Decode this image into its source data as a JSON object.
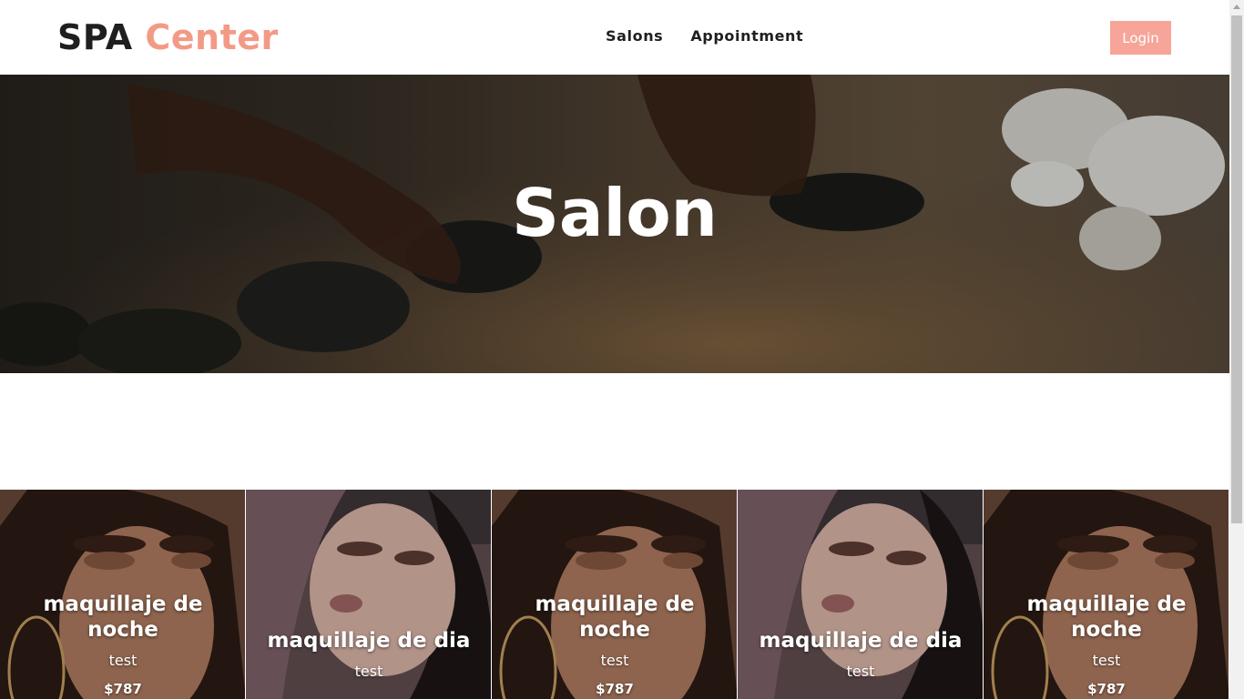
{
  "header": {
    "logo_part1": "SPA",
    "logo_part2": "Center",
    "nav": [
      "Salons",
      "Appointment"
    ],
    "login_label": "Login"
  },
  "hero": {
    "title": "Salon"
  },
  "cards": [
    {
      "title": "maquillaje de noche",
      "description": "test",
      "price": "$787"
    },
    {
      "title": "maquillaje de dia",
      "description": "test",
      "price": ""
    },
    {
      "title": "maquillaje de noche",
      "description": "test",
      "price": "$787"
    },
    {
      "title": "maquillaje de dia",
      "description": "test",
      "price": ""
    },
    {
      "title": "maquillaje de noche",
      "description": "test",
      "price": "$787"
    }
  ],
  "colors": {
    "accent": "#f39a86",
    "login_bg": "#f6a598",
    "text_dark": "#1f1f1f"
  }
}
